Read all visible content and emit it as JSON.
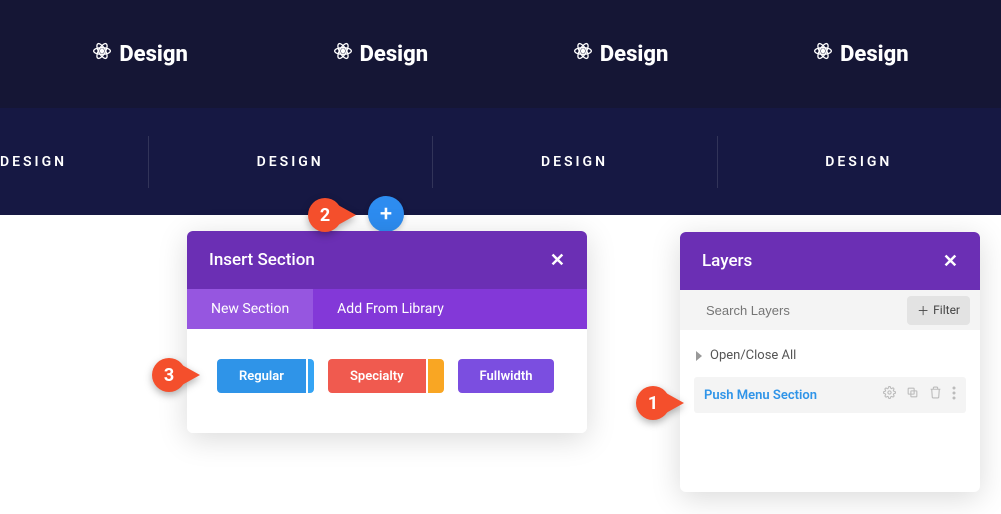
{
  "brand_label": "Design",
  "nav_label": "DESIGN",
  "add_symbol": "+",
  "insert": {
    "title": "Insert Section",
    "tabs": {
      "new": "New Section",
      "library": "Add From Library"
    },
    "buttons": {
      "regular": "Regular",
      "specialty": "Specialty",
      "fullwidth": "Fullwidth"
    }
  },
  "layers": {
    "title": "Layers",
    "search_placeholder": "Search Layers",
    "filter_label": "Filter",
    "toggle_all": "Open/Close All",
    "item": "Push Menu Section"
  },
  "callouts": {
    "one": "1",
    "two": "2",
    "three": "3"
  }
}
